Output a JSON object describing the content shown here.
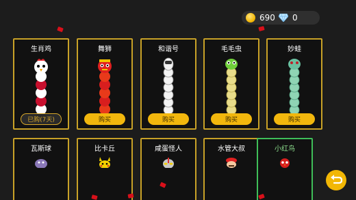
{
  "currency": {
    "coins": "690",
    "gems": "0"
  },
  "skins_row1": [
    {
      "name": "生肖鸡",
      "button": "已购(7天)",
      "owned": true
    },
    {
      "name": "舞狮",
      "button": "购买",
      "owned": false
    },
    {
      "name": "和谐号",
      "button": "购买",
      "owned": false
    },
    {
      "name": "毛毛虫",
      "button": "购买",
      "owned": false
    },
    {
      "name": "妙蛙",
      "button": "购买",
      "owned": false
    }
  ],
  "skins_row2": [
    {
      "name": "瓦斯球"
    },
    {
      "name": "比卡丘"
    },
    {
      "name": "咸蛋怪人"
    },
    {
      "name": "水管大叔"
    },
    {
      "name": "小红鸟",
      "selected": true
    }
  ],
  "colors": {
    "gold": "#c9a227",
    "button": "#f2b70d",
    "selected": "#3fbf59"
  }
}
